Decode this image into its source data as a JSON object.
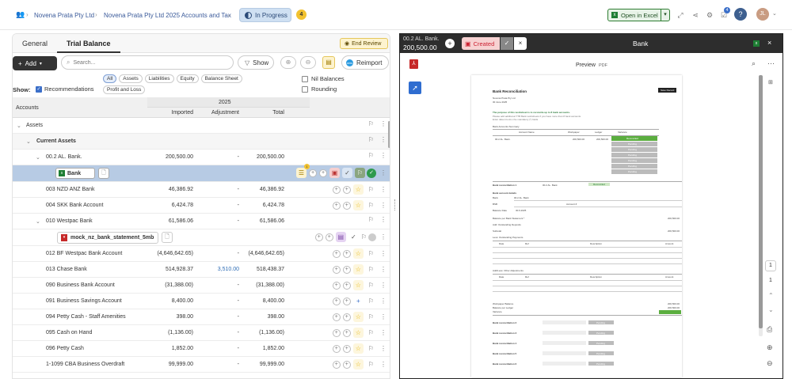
{
  "breadcrumb": {
    "client": "Novena Prata Pty Ltd",
    "job": "Novena Prata Pty Ltd 2025 Accounts and Tax",
    "status": "In Progress",
    "count": "4"
  },
  "toolbar_top": {
    "open_excel": "Open in Excel",
    "notif_count": "4",
    "avatar": "JL"
  },
  "left": {
    "tabs": [
      "General",
      "Trial Balance"
    ],
    "end_review": "End Review",
    "add": "Add",
    "search_placeholder": "Search...",
    "show_btn": "Show",
    "reimport": "Reimport",
    "show_label": "Show:",
    "recommendations": "Recommendations",
    "chips": [
      "All",
      "Assets",
      "Liabilities",
      "Equity",
      "Balance Sheet",
      "Profit and Loss"
    ],
    "nil_balances": "Nil Balances",
    "rounding": "Rounding",
    "columns": {
      "accounts": "Accounts",
      "year": "2025",
      "imported": "Imported",
      "adjustment": "Adjustment",
      "total": "Total"
    },
    "rows": [
      {
        "name": "Assets",
        "imported": "",
        "adjustment": "",
        "total": ""
      },
      {
        "name": "Current Assets",
        "imported": "",
        "adjustment": "",
        "total": ""
      },
      {
        "name": "00.2 AL. Bank.",
        "imported": "200,500.00",
        "adjustment": "-",
        "total": "200,500.00"
      },
      {
        "name": "Bank",
        "imported": "",
        "adjustment": "",
        "total": ""
      },
      {
        "name": "003 NZD ANZ Bank",
        "imported": "46,386.92",
        "adjustment": "-",
        "total": "46,386.92"
      },
      {
        "name": "004 SKK Bank Account",
        "imported": "6,424.78",
        "adjustment": "-",
        "total": "6,424.78"
      },
      {
        "name": "010 Westpac Bank",
        "imported": "61,586.06",
        "adjustment": "-",
        "total": "61,586.06"
      },
      {
        "name": "mock_nz_bank_statement_5mb",
        "imported": "",
        "adjustment": "",
        "total": ""
      },
      {
        "name": "012 BF Westpac Bank Account",
        "imported": "(4,646,642.65)",
        "adjustment": "-",
        "total": "(4,646,642.65)"
      },
      {
        "name": "013 Chase Bank",
        "imported": "514,928.37",
        "adjustment": "3,510.00",
        "total": "518,438.37"
      },
      {
        "name": "090 Business Bank Account",
        "imported": "(31,388.00)",
        "adjustment": "-",
        "total": "(31,388.00)"
      },
      {
        "name": "091 Business Savings Account",
        "imported": "8,400.00",
        "adjustment": "-",
        "total": "8,400.00"
      },
      {
        "name": "094 Petty Cash - Staff Amenities",
        "imported": "398.00",
        "adjustment": "-",
        "total": "398.00"
      },
      {
        "name": "095 Cash on Hand",
        "imported": "(1,136.00)",
        "adjustment": "-",
        "total": "(1,136.00)"
      },
      {
        "name": "096 Petty Cash",
        "imported": "1,852.00",
        "adjustment": "-",
        "total": "1,852.00"
      },
      {
        "name": "1-1099 CBA Business Overdraft",
        "imported": "99,999.00",
        "adjustment": "-",
        "total": "99,999.00"
      }
    ]
  },
  "right": {
    "acct_code": "00.2 AL. Bank.",
    "acct_amount": "200,500.00",
    "created": "Created",
    "title": "Bank",
    "preview": "Preview",
    "pdf": "PDF",
    "page_current": "1",
    "page_total": "1",
    "doc": {
      "heading": "Bank Reconciliation",
      "company": "Novena Prata Pty Ltd",
      "date": "30 June 2025",
      "button": "Save Record",
      "purpose": "The purpose of this worksheet is to reconcile up to 8 bank accounts.",
      "purpose2": "Please add additional TTB Bank worksheets if you have more than 8 bank accounts",
      "purpose3": "Enter data into ALL the mandatory (*) fields",
      "summary_title": "Bank Accounts Summary",
      "sum_cols": [
        "Account Name",
        "Workpaper",
        "Ledger",
        "Variance"
      ],
      "sum_row1": [
        "00.2 AL. Bank.",
        "200,500.00",
        "200,500.00",
        "Reconciled"
      ],
      "pending": "Pending",
      "rec1": "Bank reconciliation 1",
      "rec1_acct": "00.2 AL. Bank",
      "rec1_status": "Reconciled",
      "detail_title": "Bank account details",
      "f_bank": "Bank",
      "f_bank_val": "00.2 AL. Bank",
      "f_bsb": "BSB",
      "f_acct": "Account #",
      "f_bdate": "Balance Date",
      "f_bdate_val": "30.6.2025",
      "f_stmt": "Balance per Bank Statement *",
      "f_stmt_val": "200,500.00",
      "f_outdep": "Add: Outstanding Deposits",
      "f_sub": "Subtotal",
      "f_sub_val": "200,500.00",
      "f_less": "Less: Outstanding Payments",
      "cols_pay": [
        "Date",
        "Ref",
        "Description",
        "Amount"
      ],
      "f_other": "Add/Less: Other Adjustments",
      "f_wp": "Workpaper Balance",
      "f_wp_val": "200,500.00",
      "f_ledger": "Balance per Ledger",
      "f_ledger_val": "200,500.00",
      "f_var": "Variance",
      "recs": [
        "Bank reconciliation 2",
        "Bank reconciliation 3",
        "Bank reconciliation 4",
        "Bank reconciliation 5",
        "Bank reconciliation 6"
      ]
    }
  }
}
